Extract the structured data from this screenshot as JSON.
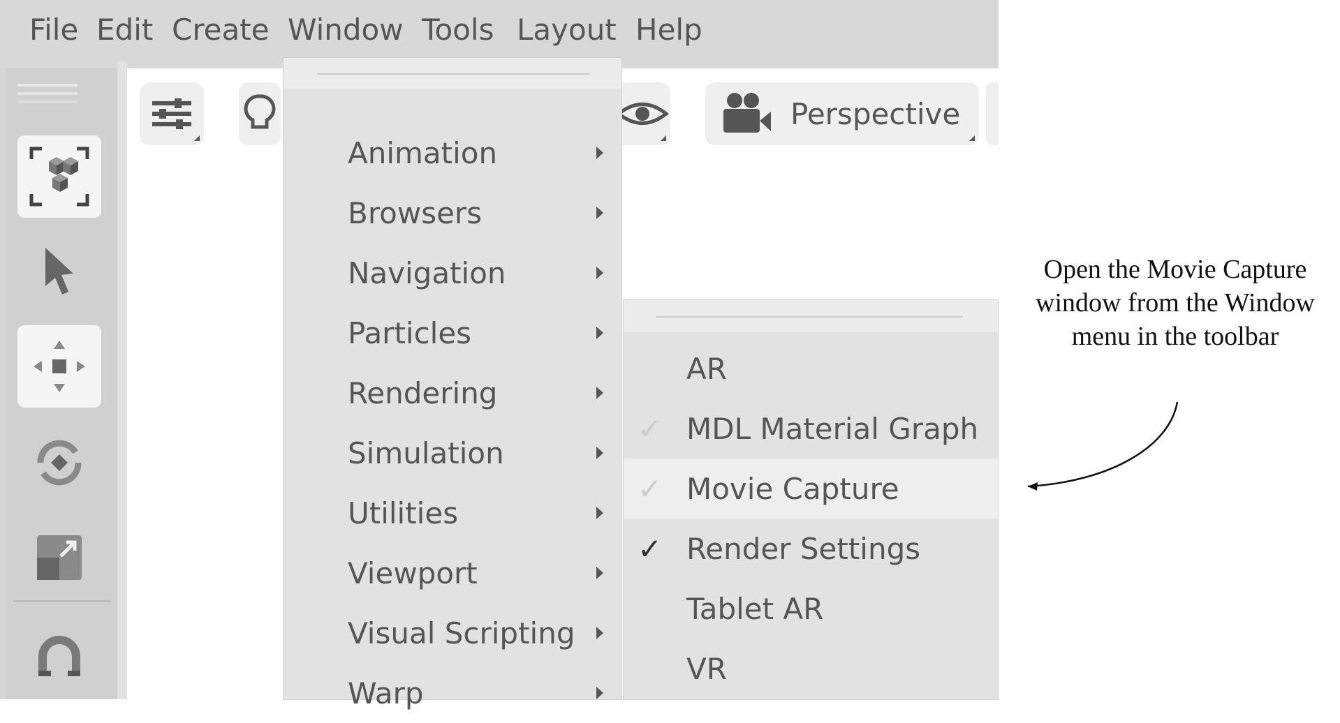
{
  "menubar": {
    "items": [
      "File",
      "Edit",
      "Create",
      "Window",
      "Tools",
      "Layout",
      "Help"
    ]
  },
  "toolbar": {
    "camera_label": "Perspective"
  },
  "window_menu": {
    "items": [
      {
        "label": "Animation"
      },
      {
        "label": "Browsers"
      },
      {
        "label": "Navigation"
      },
      {
        "label": "Particles"
      },
      {
        "label": "Rendering"
      },
      {
        "label": "Simulation"
      },
      {
        "label": "Utilities"
      },
      {
        "label": "Viewport"
      },
      {
        "label": "Visual Scripting"
      },
      {
        "label": "Warp"
      }
    ]
  },
  "submenu": {
    "items": [
      {
        "label": "AR",
        "check": "none"
      },
      {
        "label": "MDL Material Graph",
        "check": "faint"
      },
      {
        "label": "Movie Capture",
        "check": "faint",
        "highlighted": true
      },
      {
        "label": "Render Settings",
        "check": "checked"
      },
      {
        "label": "Tablet AR",
        "check": "none"
      },
      {
        "label": "VR",
        "check": "none"
      }
    ]
  },
  "annotation": {
    "text": "Open the Movie Capture window from the Window menu in the toolbar"
  },
  "colors": {
    "menubar_bg": "#d8d8d8",
    "menu_bg": "#e2e2e2",
    "text": "#555555",
    "active_tool_bg": "#f5f5f5"
  }
}
